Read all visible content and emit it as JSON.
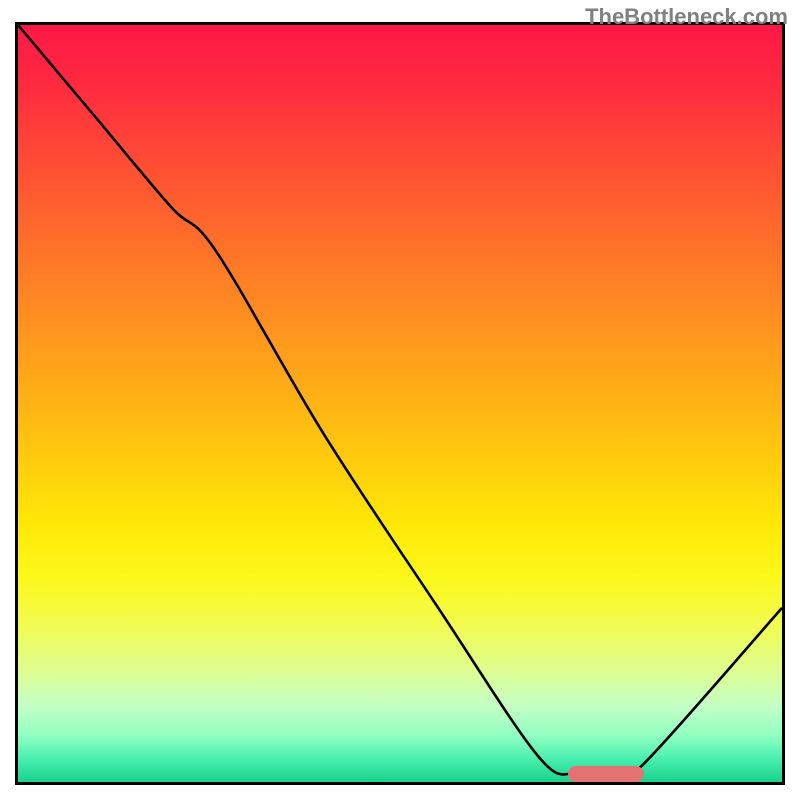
{
  "watermark": "TheBottleneck.com",
  "colors": {
    "gradient_top": "#ff1846",
    "gradient_mid": "#ffe808",
    "gradient_bottom": "#18d28c",
    "curve": "#000000",
    "border": "#000000",
    "ideal_bar": "#e57373"
  },
  "chart_data": {
    "type": "line",
    "title": "",
    "xlabel": "",
    "ylabel": "",
    "xlim": [
      0,
      100
    ],
    "ylim": [
      0,
      100
    ],
    "series": [
      {
        "name": "bottleneck-curve",
        "x": [
          0,
          10,
          20,
          26,
          40,
          55,
          68,
          73,
          78,
          82,
          100
        ],
        "y": [
          100,
          88,
          76,
          70,
          46,
          23,
          3.5,
          1.0,
          1.0,
          2.5,
          23
        ]
      }
    ],
    "ideal_range_x": [
      72,
      82
    ],
    "ideal_range_y": 1.0,
    "annotations": []
  }
}
